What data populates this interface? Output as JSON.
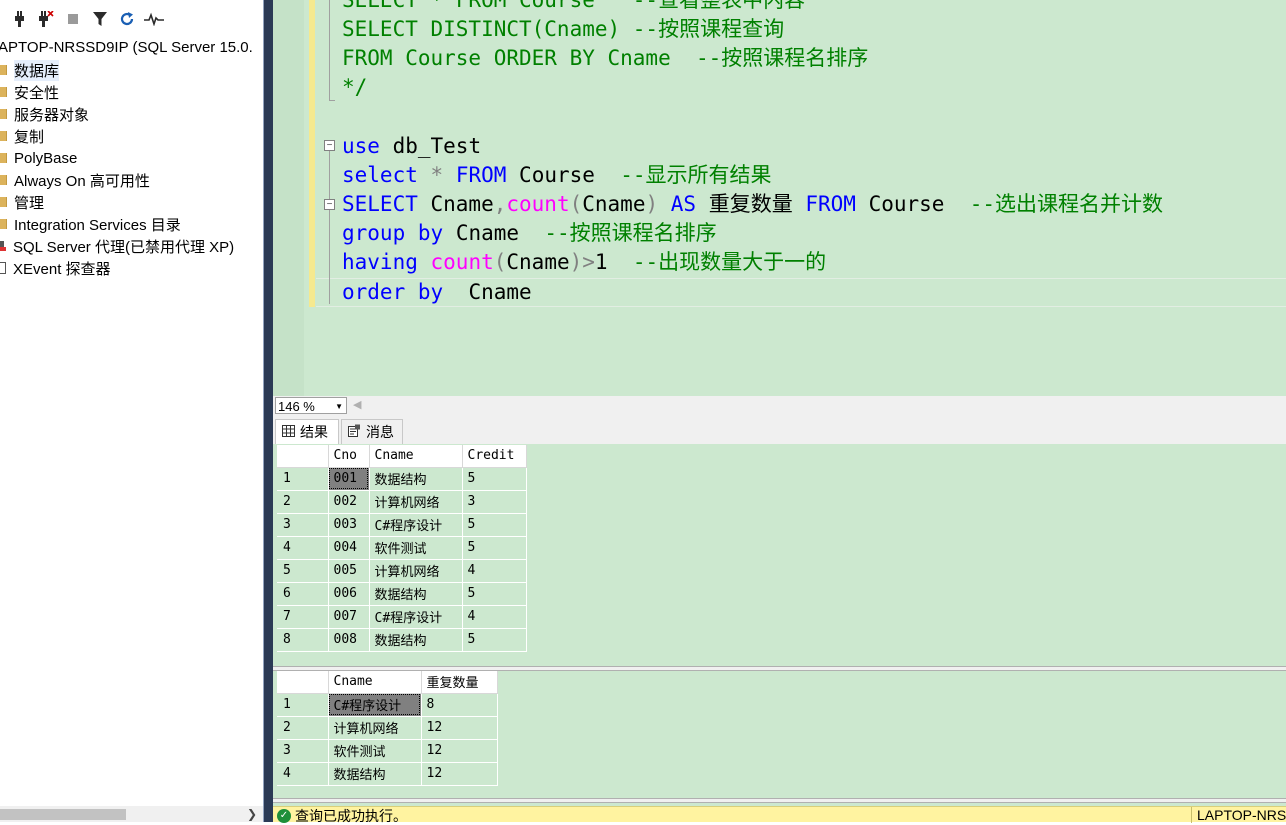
{
  "explorer": {
    "toolbar": {
      "connect_icon": "plug-icon",
      "disconnect_icon": "plug-x-icon",
      "stop_icon": "stop-icon",
      "filter_icon": "filter-icon",
      "refresh_icon": "refresh-icon",
      "activity_icon": "activity-monitor-icon"
    },
    "server_node": "APTOP-NRSSD9IP (SQL Server 15.0.",
    "items": [
      {
        "label": "数据库"
      },
      {
        "label": "安全性"
      },
      {
        "label": "服务器对象"
      },
      {
        "label": "复制"
      },
      {
        "label": "PolyBase"
      },
      {
        "label": "Always On 高可用性"
      },
      {
        "label": "管理"
      },
      {
        "label": "Integration Services 目录"
      },
      {
        "label": "SQL Server 代理(已禁用代理 XP)"
      },
      {
        "label": "XEvent 探查器"
      }
    ]
  },
  "editor": {
    "lines": [
      "SELECT * FROM Course   --查看整表中内容",
      "SELECT DISTINCT(Cname) --按照课程查询",
      "FROM Course ORDER BY Cname  --按照课程名排序",
      "*/",
      "",
      "use db_Test",
      "select * FROM Course  --显示所有结果",
      "SELECT Cname,count(Cname) AS 重复数量 FROM Course  --选出课程名并计数",
      "group by Cname  --按照课程名排序",
      "having count(Cname)>1  --出现数量大于一的",
      "order by  Cname"
    ]
  },
  "zoom": {
    "value": "146 %"
  },
  "tabs": {
    "results": "结果",
    "messages": "消息"
  },
  "grid1": {
    "columns": [
      "Cno",
      "Cname",
      "Credit"
    ],
    "rows": [
      [
        "1",
        "001",
        "数据结构",
        "5"
      ],
      [
        "2",
        "002",
        "计算机网络",
        "3"
      ],
      [
        "3",
        "003",
        "C#程序设计",
        "5"
      ],
      [
        "4",
        "004",
        "软件测试",
        "5"
      ],
      [
        "5",
        "005",
        "计算机网络",
        "4"
      ],
      [
        "6",
        "006",
        "数据结构",
        "5"
      ],
      [
        "7",
        "007",
        "C#程序设计",
        "4"
      ],
      [
        "8",
        "008",
        "数据结构",
        "5"
      ]
    ]
  },
  "grid2": {
    "columns": [
      "Cname",
      "重复数量"
    ],
    "rows": [
      [
        "1",
        "C#程序设计",
        "8"
      ],
      [
        "2",
        "计算机网络",
        "12"
      ],
      [
        "3",
        "软件测试",
        "12"
      ],
      [
        "4",
        "数据结构",
        "12"
      ]
    ]
  },
  "status": {
    "text": "查询已成功执行。",
    "server": "LAPTOP-NRS"
  },
  "colors": {
    "editor_bg": "#cce8cf",
    "keyword": "#0000ff",
    "function": "#ff00ff",
    "comment": "#008000",
    "status_bg": "#fff3a0"
  }
}
